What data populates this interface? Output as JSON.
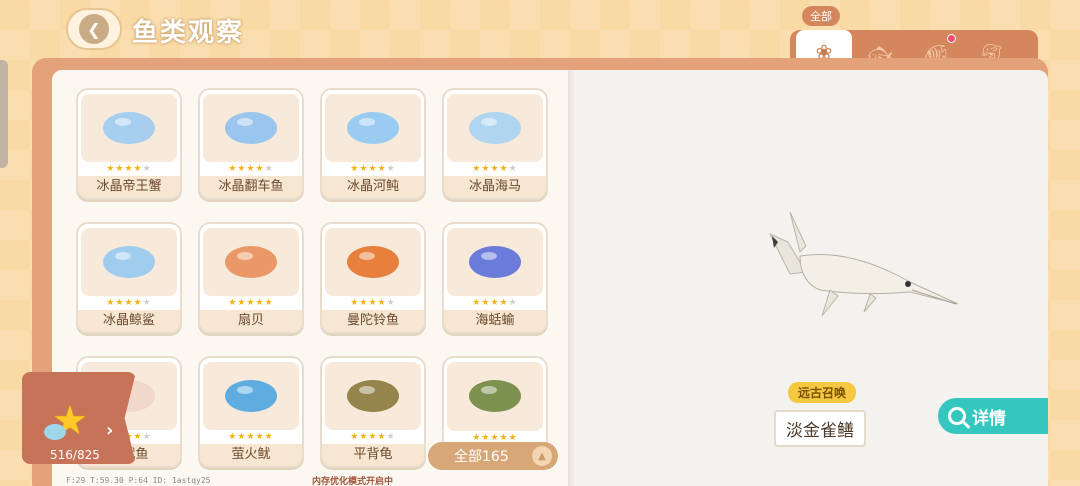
{
  "header": {
    "title": "鱼类观察"
  },
  "tabs": {
    "active_label": "全部",
    "items": [
      {
        "icon": "flower-icon",
        "active": true
      },
      {
        "icon": "fish-icon",
        "active": false
      },
      {
        "icon": "fish-dot-icon",
        "active": false,
        "badge": true
      },
      {
        "icon": "dolphin-icon",
        "active": false
      }
    ]
  },
  "cards": [
    {
      "name": "冰晶帝王蟹",
      "stars": 4,
      "max_stars": 5,
      "color": "#9ccbf0"
    },
    {
      "name": "冰晶翻车鱼",
      "stars": 4,
      "max_stars": 5,
      "color": "#8fc1ef"
    },
    {
      "name": "冰晶河鲀",
      "stars": 4,
      "max_stars": 5,
      "color": "#8fc8f2"
    },
    {
      "name": "冰晶海马",
      "stars": 4,
      "max_stars": 5,
      "color": "#a6d3f2"
    },
    {
      "name": "冰晶鲸鲨",
      "stars": 4,
      "max_stars": 5,
      "color": "#96c9ef"
    },
    {
      "name": "扇贝",
      "stars": 5,
      "max_stars": 5,
      "color": "#e98f5b"
    },
    {
      "name": "曼陀铃鱼",
      "stars": 4,
      "max_stars": 5,
      "color": "#e3742a"
    },
    {
      "name": "海蛞蝓",
      "stars": 4,
      "max_stars": 5,
      "color": "#5b6fd8"
    },
    {
      "name": "褶鱿鱼",
      "stars": 4,
      "max_stars": 5,
      "color": "#efd6c8"
    },
    {
      "name": "萤火鱿",
      "stars": 5,
      "max_stars": 5,
      "color": "#4ea6e0"
    },
    {
      "name": "平背龟",
      "stars": 4,
      "max_stars": 5,
      "color": "#8a7a3c"
    },
    {
      "name": "",
      "stars": 5,
      "max_stars": 5,
      "color": "#6f8740"
    }
  ],
  "collection": {
    "count": "516/825"
  },
  "filter": {
    "label": "全部165"
  },
  "detail": {
    "rarity": "远古召唤",
    "name": "淡金雀鳝",
    "button": "详情"
  },
  "debug": {
    "stats": "F:29   T:59.30   P:64   ID: 1astqy25",
    "memory": "内存优化模式开启中"
  }
}
